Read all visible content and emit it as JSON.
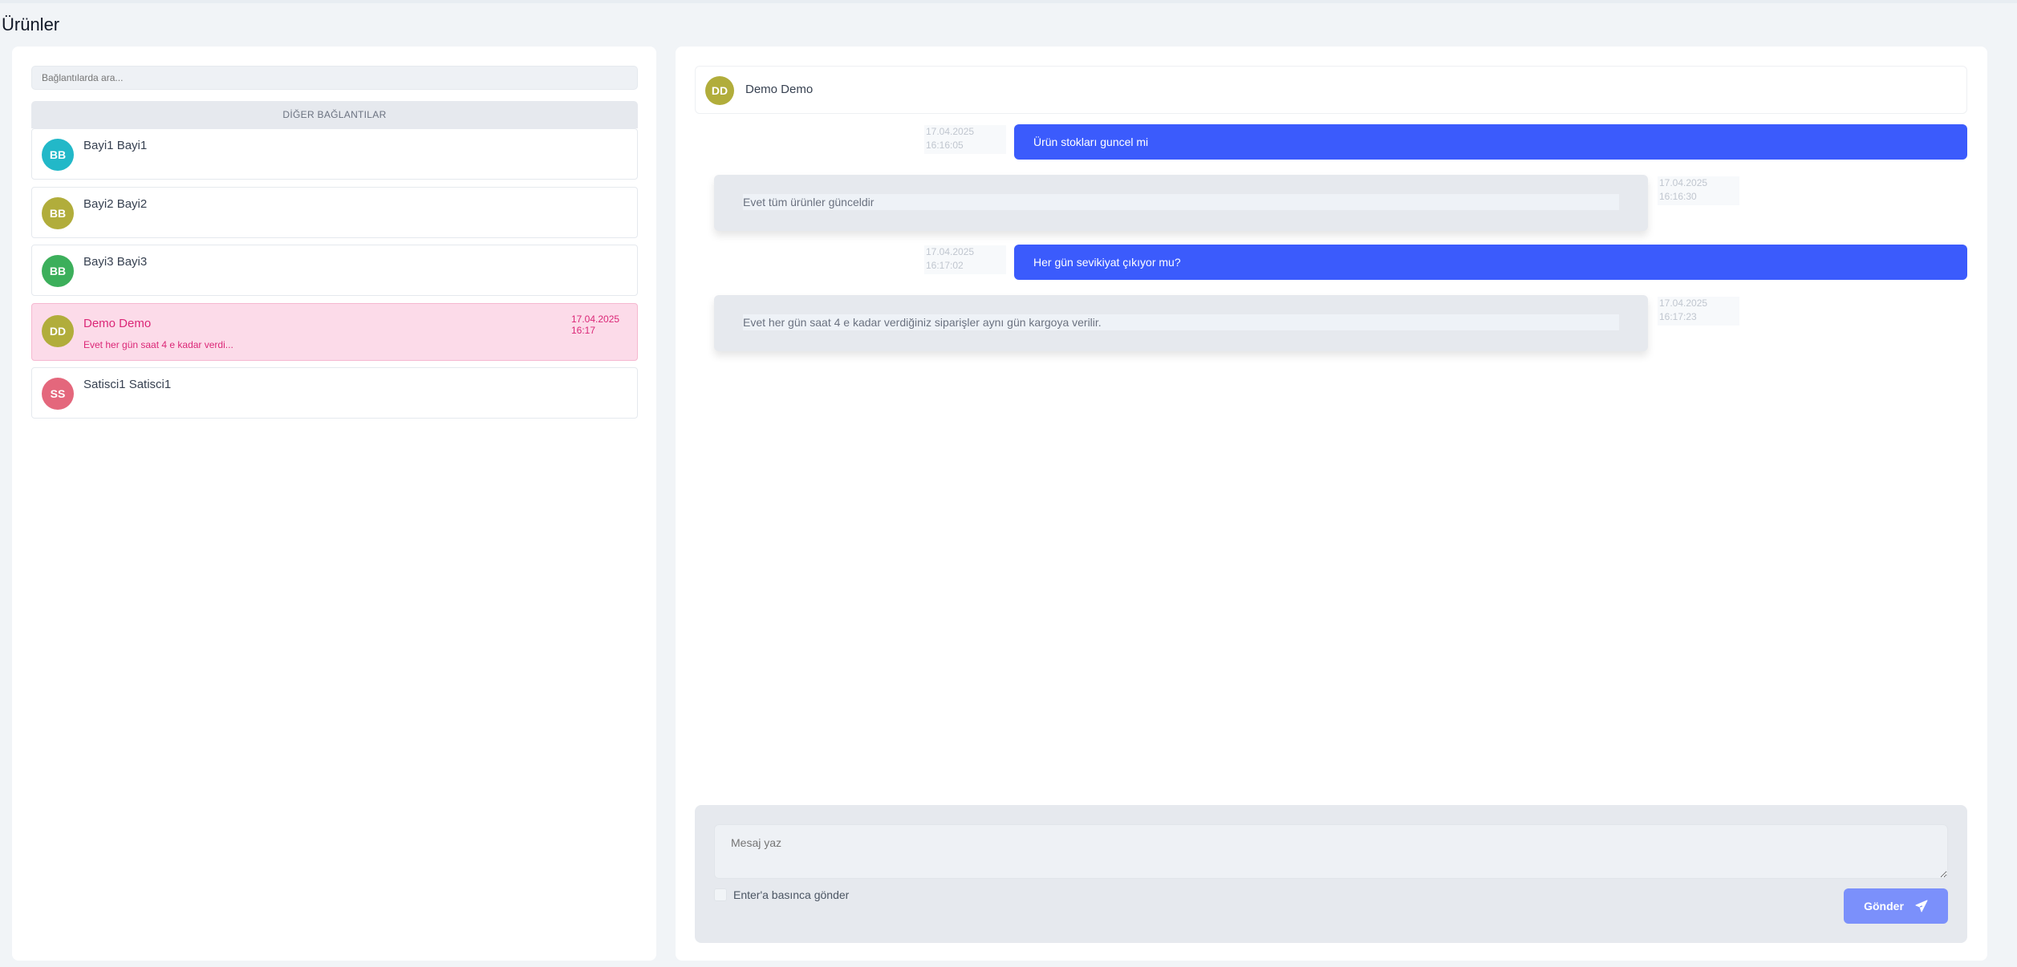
{
  "page_title": "Ürünler",
  "sidebar": {
    "search_placeholder": "Bağlantılarda ara...",
    "section_title": "DİĞER BAĞLANTILAR",
    "contacts": [
      {
        "initials": "BB",
        "name": "Bayi1 Bayi1",
        "color": "#22b8c8"
      },
      {
        "initials": "BB",
        "name": "Bayi2 Bayi2",
        "color": "#b1ad3b"
      },
      {
        "initials": "BB",
        "name": "Bayi3 Bayi3",
        "color": "#3caf5b"
      },
      {
        "initials": "DD",
        "name": "Demo Demo",
        "color": "#b1ad3b",
        "preview": "Evet her gün saat 4 e kadar verdi...",
        "date": "17.04.2025",
        "time": "16:17",
        "active": true
      },
      {
        "initials": "SS",
        "name": "Satisci1 Satisci1",
        "color": "#e4677c"
      }
    ]
  },
  "chat": {
    "header": {
      "initials": "DD",
      "name": "Demo Demo",
      "color": "#b1ad3b"
    },
    "messages": [
      {
        "direction": "out",
        "text": "Ürün stokları guncel mi",
        "date": "17.04.2025",
        "time": "16:16:05"
      },
      {
        "direction": "in",
        "text": "Evet tüm ürünler günceldir",
        "date": "17.04.2025",
        "time": "16:16:30"
      },
      {
        "direction": "out",
        "text": "Her gün sevikiyat çıkıyor mu?",
        "date": "17.04.2025",
        "time": "16:17:02"
      },
      {
        "direction": "in",
        "text": "Evet her gün saat 4 e kadar verdiğiniz siparişler aynı gün kargoya verilir.",
        "date": "17.04.2025",
        "time": "16:17:23"
      }
    ],
    "composer": {
      "placeholder": "Mesaj yaz",
      "enter_to_send_label": "Enter'a basınca gönder",
      "enter_to_send_checked": false,
      "send_label": "Gönder",
      "send_icon": "paper-plane-icon"
    }
  },
  "colors": {
    "accent": "#3b5bfc",
    "send_button": "#7b90fb",
    "active_contact_bg": "#fcdbe9",
    "active_contact_text": "#db2777"
  }
}
